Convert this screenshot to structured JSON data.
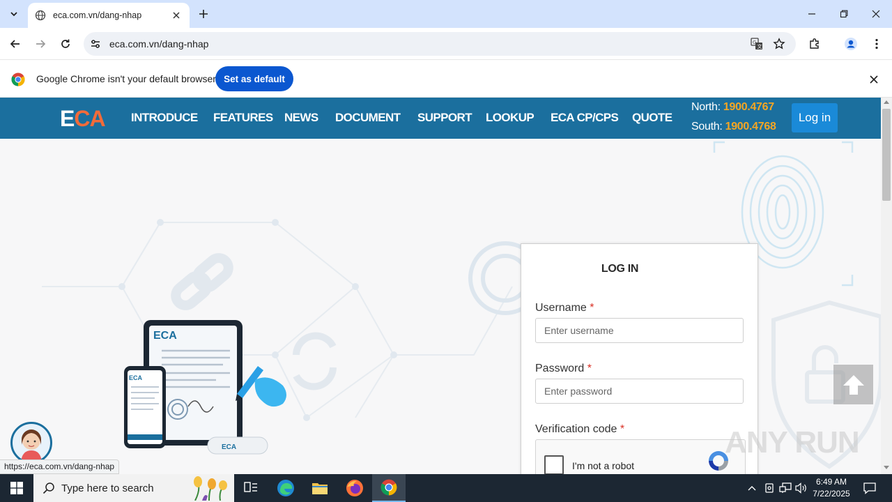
{
  "browser": {
    "tab_title": "eca.com.vn/dang-nhap",
    "url": "eca.com.vn/dang-nhap",
    "infobar_message": "Google Chrome isn't your default browser",
    "infobar_button": "Set as default",
    "status_url": "https://eca.com.vn/dang-nhap"
  },
  "site": {
    "brand_e": "E",
    "brand_ca": "CA",
    "menu": [
      "INTRODUCE",
      "FEATURES",
      "NEWS",
      "DOCUMENT",
      "SUPPORT",
      "LOOKUP",
      "ECA CP/CPS",
      "QUOTE"
    ],
    "north_label": "North: ",
    "north_number": "1900.4767",
    "south_label": "South: ",
    "south_number": "1900.4768",
    "login_button": "Log in",
    "accent_color": "#1b6f9e",
    "brand_color": "#f26b3a"
  },
  "login_form": {
    "heading": "LOG IN",
    "username_label": "Username",
    "username_placeholder": "Enter username",
    "password_label": "Password",
    "password_placeholder": "Enter password",
    "verification_label": "Verification code",
    "required_mark": "*",
    "captcha_label": "I'm not a robot"
  },
  "illustration": {
    "brand_text": "ECA"
  },
  "watermark": "ANY RUN",
  "taskbar": {
    "search_placeholder": "Type here to search",
    "time": "6:49 AM",
    "date": "7/22/2025"
  }
}
